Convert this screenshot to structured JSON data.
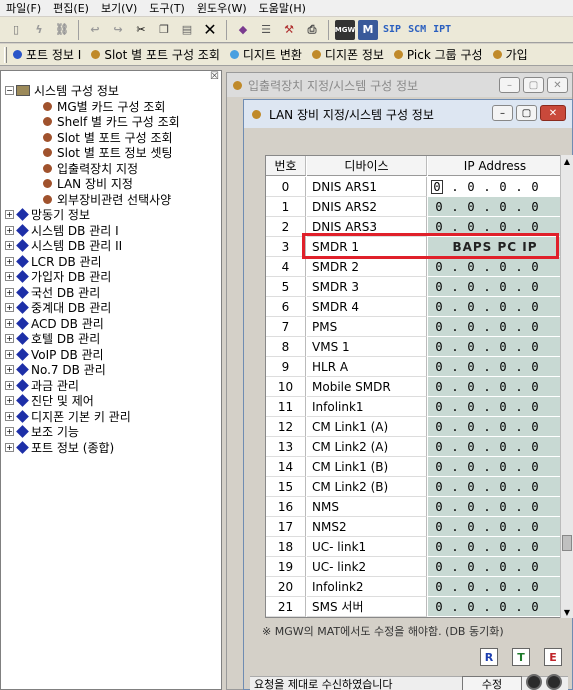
{
  "menubar": {
    "items": [
      "파일(F)",
      "편집(E)",
      "보기(V)",
      "도구(T)",
      "윈도우(W)",
      "도움말(H)"
    ]
  },
  "toolbar": {
    "text_buttons": [
      "SIP",
      "SCM",
      "IPT"
    ]
  },
  "quickbar": {
    "items": [
      {
        "label": "포트 정보 I",
        "color": "#2a55c8"
      },
      {
        "label": "Slot 별 포트 구성 조회",
        "color": "#c08a2a"
      },
      {
        "label": "디지트 변환",
        "color": "#4aa0e0"
      },
      {
        "label": "디지폰 정보",
        "color": "#c08a2a"
      },
      {
        "label": "Pick 그룹 구성",
        "color": "#c08a2a"
      },
      {
        "label": "가입",
        "color": "#c08a2a"
      }
    ]
  },
  "tree": {
    "root": "시스템  구성 정보",
    "children": [
      "MG별 카드 구성 조회",
      "Shelf 별 카드 구성 조회",
      "Slot 별 포트 구성 조회",
      "Slot 별 포트 정보 셋팅",
      "입출력장치 지정",
      "LAN 장비 지정",
      "외부장비관련 선택사양"
    ],
    "groups": [
      "망동기 정보",
      "시스템 DB 관리 I",
      "시스템 DB 관리 II",
      "LCR DB 관리",
      "가입자 DB 관리",
      "국선 DB 관리",
      "중계대 DB 관리",
      "ACD DB 관리",
      "호텔 DB 관리",
      "VoIP DB 관리",
      "No.7 DB 관리",
      "과금 관리",
      "진단 및 제어",
      "디지폰 기본 키 관리",
      "보조 기능",
      "포트 정보 (종합)"
    ]
  },
  "back_window": {
    "title": "입출력장치 지정/시스템  구성 정보"
  },
  "dialog": {
    "title": "LAN 장비 지정/시스템  구성 정보",
    "headers": {
      "num": "번호",
      "device": "디바이스",
      "ip": "IP Address"
    },
    "rows": [
      {
        "num": "0",
        "device": "DNIS ARS1",
        "ip": [
          "0",
          "0",
          "0",
          "0"
        ]
      },
      {
        "num": "1",
        "device": "DNIS ARS2",
        "ip": [
          "0",
          "0",
          "0",
          "0"
        ]
      },
      {
        "num": "2",
        "device": "DNIS ARS3",
        "ip": [
          "0",
          "0",
          "0",
          "0"
        ]
      },
      {
        "num": "3",
        "device": "SMDR 1",
        "ip_text": "BAPS PC IP"
      },
      {
        "num": "4",
        "device": "SMDR 2",
        "ip": [
          "0",
          "0",
          "0",
          "0"
        ]
      },
      {
        "num": "5",
        "device": "SMDR 3",
        "ip": [
          "0",
          "0",
          "0",
          "0"
        ]
      },
      {
        "num": "6",
        "device": "SMDR 4",
        "ip": [
          "0",
          "0",
          "0",
          "0"
        ]
      },
      {
        "num": "7",
        "device": "PMS",
        "ip": [
          "0",
          "0",
          "0",
          "0"
        ]
      },
      {
        "num": "8",
        "device": "VMS 1",
        "ip": [
          "0",
          "0",
          "0",
          "0"
        ]
      },
      {
        "num": "9",
        "device": "HLR A",
        "ip": [
          "0",
          "0",
          "0",
          "0"
        ]
      },
      {
        "num": "10",
        "device": "Mobile SMDR",
        "ip": [
          "0",
          "0",
          "0",
          "0"
        ]
      },
      {
        "num": "11",
        "device": "Infolink1",
        "ip": [
          "0",
          "0",
          "0",
          "0"
        ]
      },
      {
        "num": "12",
        "device": "CM Link1 (A)",
        "ip": [
          "0",
          "0",
          "0",
          "0"
        ]
      },
      {
        "num": "13",
        "device": "CM Link2 (A)",
        "ip": [
          "0",
          "0",
          "0",
          "0"
        ]
      },
      {
        "num": "14",
        "device": "CM Link1 (B)",
        "ip": [
          "0",
          "0",
          "0",
          "0"
        ]
      },
      {
        "num": "15",
        "device": "CM Link2 (B)",
        "ip": [
          "0",
          "0",
          "0",
          "0"
        ]
      },
      {
        "num": "16",
        "device": "NMS",
        "ip": [
          "0",
          "0",
          "0",
          "0"
        ]
      },
      {
        "num": "17",
        "device": "NMS2",
        "ip": [
          "0",
          "0",
          "0",
          "0"
        ]
      },
      {
        "num": "18",
        "device": "UC- link1",
        "ip": [
          "0",
          "0",
          "0",
          "0"
        ]
      },
      {
        "num": "19",
        "device": "UC- link2",
        "ip": [
          "0",
          "0",
          "0",
          "0"
        ]
      },
      {
        "num": "20",
        "device": "Infolink2",
        "ip": [
          "0",
          "0",
          "0",
          "0"
        ]
      },
      {
        "num": "21",
        "device": "SMS 서버",
        "ip": [
          "0",
          "0",
          "0",
          "0"
        ]
      }
    ],
    "note": "※  MGW의 MAT에서도 수정을 해야함. (DB 동기화)",
    "bottom_icons": [
      {
        "label": "R",
        "color": "#1d3fb0"
      },
      {
        "label": "T",
        "color": "#1d7a2a"
      },
      {
        "label": "E",
        "color": "#c0242a"
      }
    ],
    "status_text": "요청을 제대로 수신하였습니다",
    "edit_button": "수정"
  },
  "colors": {
    "ip_cell": "#c8d9d3",
    "highlight": "#e0202a",
    "accent": "#2a55c8"
  }
}
